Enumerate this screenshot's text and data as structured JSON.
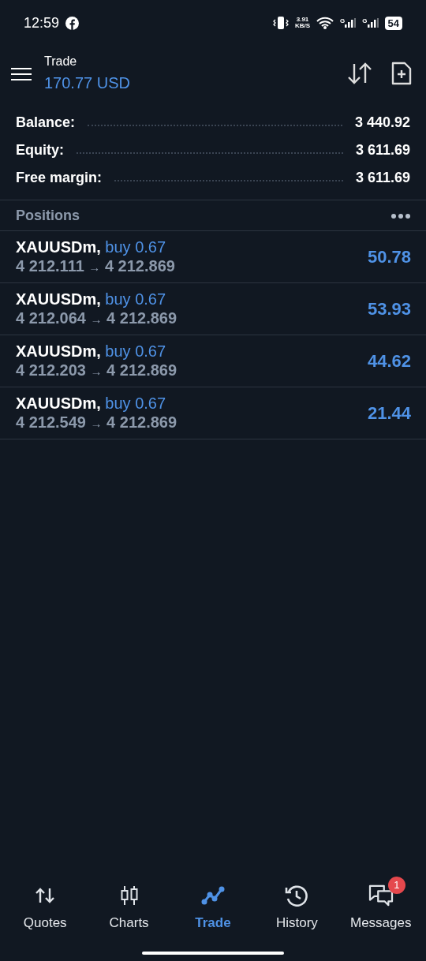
{
  "status_bar": {
    "time": "12:59",
    "speed": "3.91",
    "speed_unit": "KB/S",
    "network_1": "G",
    "network_2": "G",
    "battery": "54"
  },
  "header": {
    "title": "Trade",
    "subtitle": "170.77 USD"
  },
  "summary": [
    {
      "label": "Balance:",
      "value": "3 440.92"
    },
    {
      "label": "Equity:",
      "value": "3 611.69"
    },
    {
      "label": "Free margin:",
      "value": "3 611.69"
    }
  ],
  "positions": {
    "title": "Positions",
    "rows": [
      {
        "symbol": "XAUUSDm,",
        "side": "buy 0.67",
        "open": "4 212.111",
        "arrow": "→",
        "current": "4 212.869",
        "profit": "50.78"
      },
      {
        "symbol": "XAUUSDm,",
        "side": "buy 0.67",
        "open": "4 212.064",
        "arrow": "→",
        "current": "4 212.869",
        "profit": "53.93"
      },
      {
        "symbol": "XAUUSDm,",
        "side": "buy 0.67",
        "open": "4 212.203",
        "arrow": "→",
        "current": "4 212.869",
        "profit": "44.62"
      },
      {
        "symbol": "XAUUSDm,",
        "side": "buy 0.67",
        "open": "4 212.549",
        "arrow": "→",
        "current": "4 212.869",
        "profit": "21.44"
      }
    ]
  },
  "nav": [
    {
      "label": "Quotes",
      "kind": "quotes",
      "selected": false
    },
    {
      "label": "Charts",
      "kind": "charts",
      "selected": false
    },
    {
      "label": "Trade",
      "kind": "trade",
      "selected": true
    },
    {
      "label": "History",
      "kind": "history",
      "selected": false
    },
    {
      "label": "Messages",
      "kind": "messages",
      "selected": false,
      "badge": "1"
    }
  ]
}
